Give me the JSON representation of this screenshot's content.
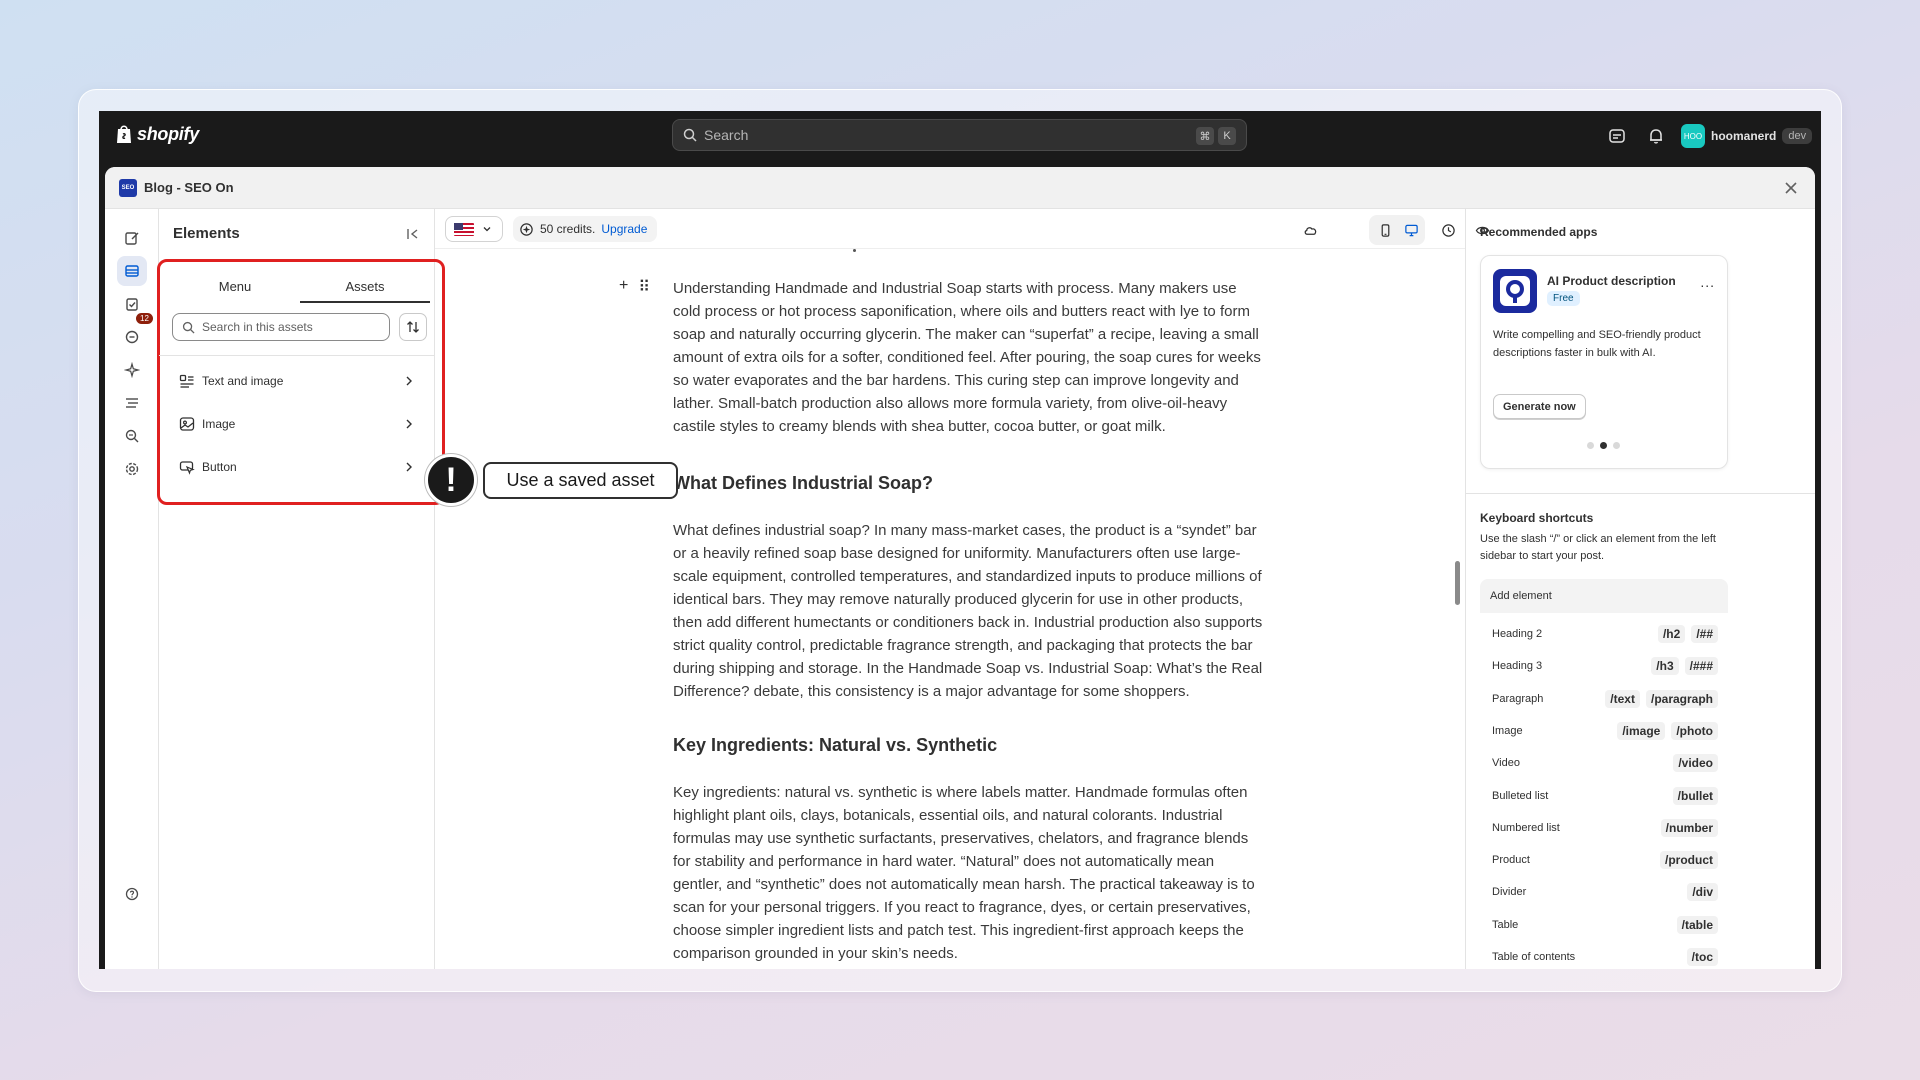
{
  "topbar": {
    "brand": "shopify",
    "search_placeholder": "Search",
    "kbd1": "⌘",
    "kbd2": "K",
    "user_initials": "HOO",
    "username": "hoomanerd",
    "user_tag": "dev"
  },
  "app": {
    "badge": "SEO",
    "title": "Blog - SEO On"
  },
  "rail": {
    "notification_count": "12"
  },
  "panel": {
    "title": "Elements",
    "tabs": [
      {
        "label": "Menu"
      },
      {
        "label": "Assets"
      }
    ],
    "search_placeholder": "Search in this assets",
    "items": [
      {
        "label": "Text and image",
        "icon": "text-image-icon"
      },
      {
        "label": "Image",
        "icon": "image-icon"
      },
      {
        "label": "Button",
        "icon": "button-icon"
      }
    ]
  },
  "callout": {
    "mark": "!",
    "label": "Use a saved asset"
  },
  "toolbar": {
    "credits": "50 credits.",
    "upgrade": "Upgrade"
  },
  "editor": {
    "p1": "Understanding Handmade and Industrial Soap starts with process. Many makers use cold process or hot process saponification, where oils and butters react with lye to form soap and naturally occurring glycerin. The maker can “superfat” a recipe, leaving a small amount of extra oils for a softer, conditioned feel. After pouring, the soap cures for weeks so water evaporates and the bar hardens. This curing step can improve longevity and lather. Small-batch production also allows more formula variety, from olive-oil-heavy castile styles to creamy blends with shea butter, cocoa butter, or goat milk.",
    "h1": "What Defines Industrial Soap?",
    "p2": "What defines industrial soap? In many mass-market cases, the product is a “syndet” bar or a heavily refined soap base designed for uniformity. Manufacturers often use large-scale equipment, controlled temperatures, and standardized inputs to produce millions of identical bars. They may remove naturally produced glycerin for use in other products, then add different humectants or conditioners back in. Industrial production also supports strict quality control, predictable fragrance strength, and packaging that protects the bar during shipping and storage. In the Handmade Soap vs. Industrial Soap: What’s the Real Difference? debate, this consistency is a major advantage for some shoppers.",
    "h2": "Key Ingredients: Natural vs. Synthetic",
    "p3": "Key ingredients: natural vs. synthetic is where labels matter. Handmade formulas often highlight plant oils, clays, botanicals, essential oils, and natural colorants. Industrial formulas may use synthetic surfactants, preservatives, chelators, and fragrance blends for stability and performance in hard water. “Natural” does not automatically mean gentler, and “synthetic” does not automatically mean harsh. The practical takeaway is to scan for your personal triggers. If you react to fragrance, dyes, or certain preservatives, choose simpler ingredient lists and patch test. This ingredient-first approach keeps the comparison grounded in your skin’s needs."
  },
  "sidebar": {
    "rec_title": "Recommended apps",
    "app_name": "AI Product description",
    "app_badge": "Free",
    "app_more": "...",
    "app_desc": "Write compelling and SEO-friendly product descriptions faster in bulk with AI.",
    "app_button": "Generate now",
    "ks_title": "Keyboard shortcuts",
    "ks_desc": "Use the slash “/” or click an element from the left sidebar to start your post.",
    "ks_head": "Add element",
    "shortcuts": [
      {
        "label": "Heading 2",
        "keys": [
          "/h2",
          "/##"
        ]
      },
      {
        "label": "Heading 3",
        "keys": [
          "/h3",
          "/###"
        ]
      },
      {
        "label": "Paragraph",
        "keys": [
          "/text",
          "/paragraph"
        ]
      },
      {
        "label": "Image",
        "keys": [
          "/image",
          "/photo"
        ]
      },
      {
        "label": "Video",
        "keys": [
          "/video"
        ]
      },
      {
        "label": "Bulleted list",
        "keys": [
          "/bullet"
        ]
      },
      {
        "label": "Numbered list",
        "keys": [
          "/number"
        ]
      },
      {
        "label": "Product",
        "keys": [
          "/product"
        ]
      },
      {
        "label": "Divider",
        "keys": [
          "/div"
        ]
      },
      {
        "label": "Table",
        "keys": [
          "/table"
        ]
      },
      {
        "label": "Table of contents",
        "keys": [
          "/toc"
        ]
      }
    ]
  },
  "colors": {
    "highlight": "#e02020",
    "link": "#005bd3",
    "topbar": "#1a1a1a"
  }
}
